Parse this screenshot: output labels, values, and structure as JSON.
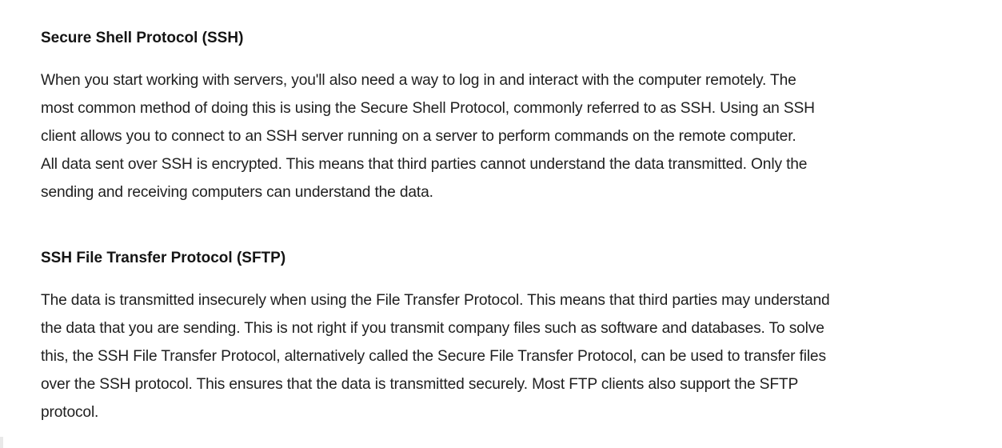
{
  "sections": [
    {
      "heading": "Secure Shell Protocol (SSH)",
      "lines": [
        "When you start working with servers, you'll also need a way to log in and interact with the computer remotely. The",
        "most common method of doing this is using the Secure Shell Protocol, commonly referred to as SSH. Using an SSH",
        "client allows you to connect to an SSH server running on a server to perform commands on the remote computer.",
        "All data sent over SSH is encrypted. This means that third parties cannot understand the data transmitted. Only the",
        "sending and receiving computers can understand the data."
      ]
    },
    {
      "heading": "SSH File Transfer Protocol (SFTP)",
      "lines": [
        "The data is transmitted insecurely when using the File Transfer Protocol. This means that third parties may understand",
        "the data that you are sending. This is not right if you transmit company files such as software and databases. To solve",
        "this, the SSH File Transfer Protocol, alternatively called the Secure File Transfer Protocol, can be used to transfer files",
        "over the SSH protocol. This ensures that the data is transmitted securely. Most FTP clients also support the SFTP",
        "protocol."
      ]
    }
  ]
}
